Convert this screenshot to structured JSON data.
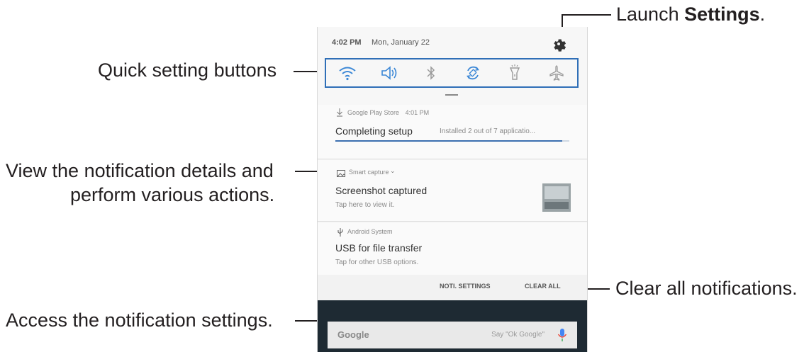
{
  "callouts": {
    "launch_prefix": "Launch ",
    "launch_bold": "Settings",
    "launch_suffix": ".",
    "quick_settings": "Quick setting buttons",
    "view_details_line1": "View the notification details and",
    "view_details_line2": "perform various actions.",
    "clear_all": "Clear all notifications.",
    "access_settings": "Access the notification settings."
  },
  "status": {
    "time": "4:02 PM",
    "date": "Mon, January 22"
  },
  "quick_settings": {
    "buttons": [
      {
        "icon": "wifi-icon"
      },
      {
        "icon": "sound-icon"
      },
      {
        "icon": "bluetooth-icon"
      },
      {
        "icon": "auto-rotate-icon"
      },
      {
        "icon": "flashlight-icon"
      },
      {
        "icon": "airplane-mode-icon"
      }
    ],
    "accent": "#2f6fb7"
  },
  "notifications": [
    {
      "app": "Google Play Store",
      "time": "4:01 PM",
      "title": "Completing setup",
      "detail": "Installed 2 out of 7 applicatio...",
      "progress": 0.97
    },
    {
      "app": "Smart capture",
      "title": "Screenshot captured",
      "detail": "Tap here to view it."
    },
    {
      "app": "Android System",
      "title": "USB for file transfer",
      "detail": "Tap for other USB options."
    }
  ],
  "actions": {
    "noti_settings": "NOTI. SETTINGS",
    "clear_all": "CLEAR ALL"
  },
  "home": {
    "search_logo": "Google",
    "search_hint": "Say \"Ok Google\""
  }
}
